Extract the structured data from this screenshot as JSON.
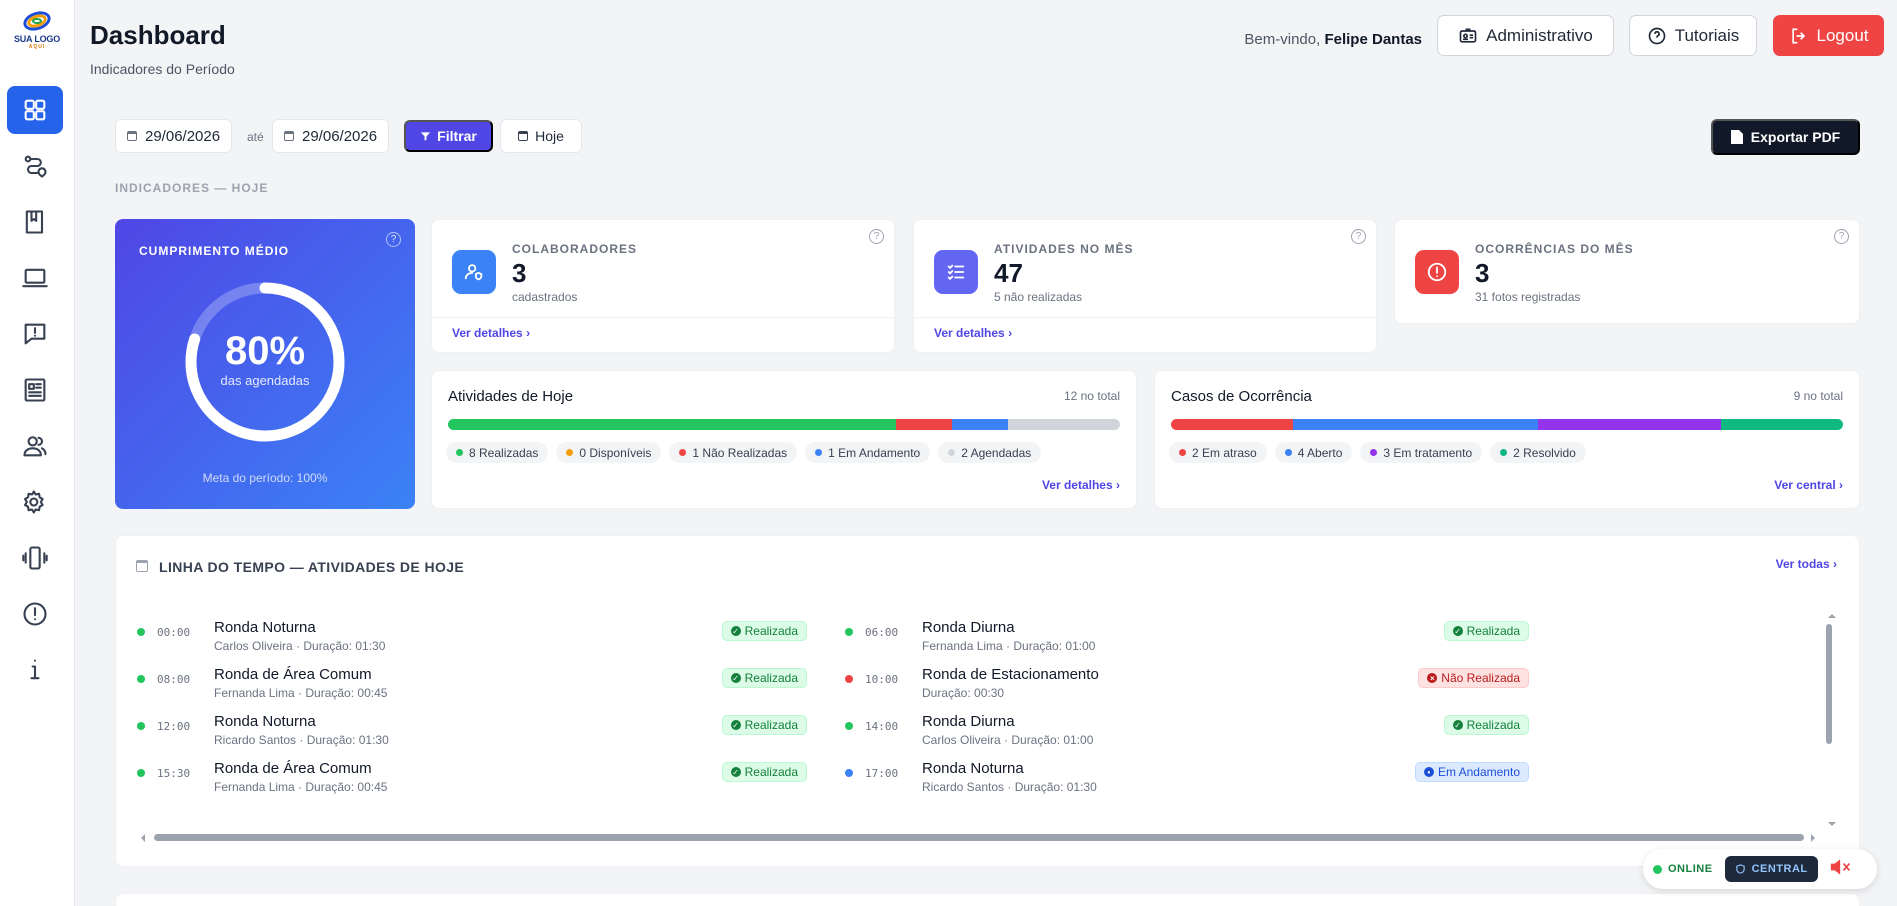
{
  "logo": {
    "text": "SUA LOGO",
    "sub": "AQUI"
  },
  "sidebar": {
    "items": [
      {
        "icon": "grid-icon",
        "active": true
      },
      {
        "icon": "route-icon",
        "active": false
      },
      {
        "icon": "book-icon",
        "active": false
      },
      {
        "icon": "laptop-icon",
        "active": false
      },
      {
        "icon": "alert-message-icon",
        "active": false
      },
      {
        "icon": "report-icon",
        "active": false
      },
      {
        "icon": "users-icon",
        "active": false
      },
      {
        "icon": "settings-icon",
        "active": false
      },
      {
        "icon": "phone-vibrate-icon",
        "active": false
      },
      {
        "icon": "alert-circle-icon",
        "active": false
      },
      {
        "icon": "info-icon",
        "active": false
      }
    ]
  },
  "header": {
    "title": "Dashboard",
    "subtitle": "Indicadores do Período",
    "welcome_prefix": "Bem-vindo,",
    "user_name": "Felipe Dantas",
    "admin_label": "Administrativo",
    "tutorials_label": "Tutoriais",
    "logout_label": "Logout"
  },
  "filters": {
    "date_from": "29/06/2026",
    "until_label": "até",
    "date_to": "29/06/2026",
    "filter_label": "Filtrar",
    "today_label": "Hoje",
    "export_label": "Exportar PDF"
  },
  "section_label": "INDICADORES — HOJE",
  "hero": {
    "title": "CUMPRIMENTO MÉDIO",
    "help": "?",
    "percent": "80%",
    "percent_value": 0.8,
    "percent_label": "das agendadas",
    "meta": "Meta do período: 100%"
  },
  "stats": [
    {
      "label": "COLABORADORES",
      "value": "3",
      "sub": "cadastrados",
      "link": "Ver detalhes",
      "icon": "user-shield-icon",
      "color": "#3b82f6",
      "help": "?"
    },
    {
      "label": "ATIVIDADES NO MÊS",
      "value": "47",
      "sub": "5 não realizadas",
      "link": "Ver detalhes",
      "icon": "checklist-icon",
      "color": "#6366f1",
      "help": "?"
    },
    {
      "label": "OCORRÊNCIAS DO MÊS",
      "value": "3",
      "sub": "31 fotos registradas",
      "icon": "alert-icon",
      "color": "#ef4444",
      "help": "?"
    }
  ],
  "activities": {
    "title": "Atividades de Hoje",
    "total": "12 no total",
    "segments": [
      {
        "label": "8 Realizadas",
        "value": 8,
        "color": "#22c55e"
      },
      {
        "label": "0 Disponíveis",
        "value": 0,
        "color": "#f59e0b"
      },
      {
        "label": "1 Não Realizadas",
        "value": 1,
        "color": "#ef4444"
      },
      {
        "label": "1 Em Andamento",
        "value": 1,
        "color": "#3b82f6"
      },
      {
        "label": "2 Agendadas",
        "value": 2,
        "color": "#d1d5db"
      }
    ],
    "link": "Ver detalhes"
  },
  "cases": {
    "title": "Casos de Ocorrência",
    "total": "9 no total",
    "segments": [
      {
        "label": "2 Em atraso",
        "value": 2,
        "color": "#ef4444"
      },
      {
        "label": "4 Aberto",
        "value": 4,
        "color": "#3b82f6"
      },
      {
        "label": "3 Em tratamento",
        "value": 3,
        "color": "#9333ea"
      },
      {
        "label": "2 Resolvido",
        "value": 2,
        "color": "#10b981"
      }
    ],
    "link": "Ver central"
  },
  "timeline": {
    "title": "LINHA DO TEMPO — ATIVIDADES DE HOJE",
    "link": "Ver todas",
    "items": [
      {
        "time": "00:00",
        "name": "Ronda Noturna",
        "meta": "Carlos Oliveira · Duração: 01:30",
        "status": "Realizada",
        "kind": "ok",
        "dot": "#22c55e"
      },
      {
        "time": "06:00",
        "name": "Ronda Diurna",
        "meta": "Fernanda Lima · Duração: 01:00",
        "status": "Realizada",
        "kind": "ok",
        "dot": "#22c55e"
      },
      {
        "time": "08:00",
        "name": "Ronda de Área Comum",
        "meta": "Fernanda Lima · Duração: 00:45",
        "status": "Realizada",
        "kind": "ok",
        "dot": "#22c55e"
      },
      {
        "time": "10:00",
        "name": "Ronda de Estacionamento",
        "meta": "Duração: 00:30",
        "status": "Não Realizada",
        "kind": "no",
        "dot": "#ef4444"
      },
      {
        "time": "12:00",
        "name": "Ronda Noturna",
        "meta": "Ricardo Santos · Duração: 01:30",
        "status": "Realizada",
        "kind": "ok",
        "dot": "#22c55e"
      },
      {
        "time": "14:00",
        "name": "Ronda Diurna",
        "meta": "Carlos Oliveira · Duração: 01:00",
        "status": "Realizada",
        "kind": "ok",
        "dot": "#22c55e"
      },
      {
        "time": "15:30",
        "name": "Ronda de Área Comum",
        "meta": "Fernanda Lima · Duração: 00:45",
        "status": "Realizada",
        "kind": "ok",
        "dot": "#22c55e"
      },
      {
        "time": "17:00",
        "name": "Ronda Noturna",
        "meta": "Ricardo Santos · Duração: 01:30",
        "status": "Em Andamento",
        "kind": "prog",
        "dot": "#3b82f6"
      }
    ]
  },
  "status_widget": {
    "online": "ONLINE",
    "central": "CENTRAL"
  }
}
